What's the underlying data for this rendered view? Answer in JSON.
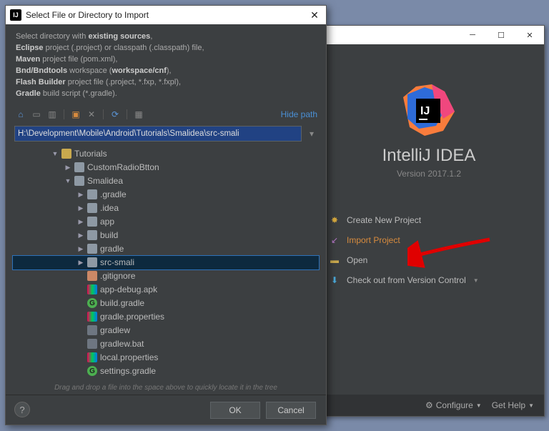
{
  "welcome": {
    "app_name": "IntelliJ IDEA",
    "version": "Version 2017.1.2",
    "actions": {
      "new": "Create New Project",
      "import": "Import Project",
      "open": "Open",
      "checkout": "Check out from Version Control"
    },
    "footer": {
      "configure": "Configure",
      "help": "Get Help"
    }
  },
  "dialog": {
    "title": "Select File or Directory to Import",
    "desc_lead": "Select directory with ",
    "desc_bold1": "existing sources",
    "desc_l2a": "Eclipse",
    "desc_l2b": " project (.project) or classpath (.classpath) file,",
    "desc_l3a": "Maven",
    "desc_l3b": " project file (pom.xml),",
    "desc_l4a": "Bnd/Bndtools",
    "desc_l4b": " workspace (",
    "desc_l4c": "workspace/cnf",
    "desc_l4d": "),",
    "desc_l5a": "Flash Builder",
    "desc_l5b": " project file (.project, *.fxp, *.fxpl),",
    "desc_l6a": "Gradle",
    "desc_l6b": " build script (*.gradle).",
    "hide_path": "Hide path",
    "path": "H:\\Development\\Mobile\\Android\\Tutorials\\Smalidea\\src-smali",
    "tree": [
      {
        "indent": 3,
        "arrow": "down",
        "icon": "folder-y",
        "label": "Tutorials"
      },
      {
        "indent": 4,
        "arrow": "right",
        "icon": "folder-ic",
        "label": "CustomRadioBtton"
      },
      {
        "indent": 4,
        "arrow": "down",
        "icon": "folder-ic",
        "label": "Smalidea"
      },
      {
        "indent": 5,
        "arrow": "right",
        "icon": "folder-ic",
        "label": ".gradle"
      },
      {
        "indent": 5,
        "arrow": "right",
        "icon": "folder-ic",
        "label": ".idea"
      },
      {
        "indent": 5,
        "arrow": "right",
        "icon": "folder-ic",
        "label": "app"
      },
      {
        "indent": 5,
        "arrow": "right",
        "icon": "folder-ic",
        "label": "build"
      },
      {
        "indent": 5,
        "arrow": "right",
        "icon": "folder-ic",
        "label": "gradle"
      },
      {
        "indent": 5,
        "arrow": "right",
        "icon": "folder-ic",
        "label": "src-smali",
        "selected": true
      },
      {
        "indent": 5,
        "arrow": "none",
        "icon": "git-ic",
        "label": ".gitignore"
      },
      {
        "indent": 5,
        "arrow": "none",
        "icon": "prop-ic",
        "label": "app-debug.apk"
      },
      {
        "indent": 5,
        "arrow": "none",
        "icon": "gradle-ic",
        "label": "build.gradle"
      },
      {
        "indent": 5,
        "arrow": "none",
        "icon": "prop-ic",
        "label": "gradle.properties"
      },
      {
        "indent": 5,
        "arrow": "none",
        "icon": "file-ic",
        "label": "gradlew"
      },
      {
        "indent": 5,
        "arrow": "none",
        "icon": "file-ic",
        "label": "gradlew.bat"
      },
      {
        "indent": 5,
        "arrow": "none",
        "icon": "prop-ic",
        "label": "local.properties"
      },
      {
        "indent": 5,
        "arrow": "none",
        "icon": "gradle-ic",
        "label": "settings.gradle"
      }
    ],
    "hint": "Drag and drop a file into the space above to quickly locate it in the tree",
    "ok": "OK",
    "cancel": "Cancel"
  }
}
